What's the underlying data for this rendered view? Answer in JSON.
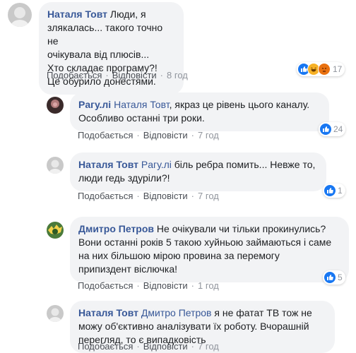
{
  "comments": [
    {
      "author": "Наталя Товт",
      "lines": [
        "Люди, я злякалась... такого точно не",
        "очікувала від плюсів...",
        "Хто складає програму?!",
        "Це обурило донестями."
      ],
      "like_label": "Подобається",
      "reply_label": "Відповісти",
      "time": "8 год",
      "reactions": [
        "like",
        "haha",
        "angry"
      ],
      "reaction_count": "17"
    },
    {
      "author": "Paгу.лі",
      "mention": "Наталя Товт",
      "lines": [
        ", якраз це рівень цього каналу.",
        "Особливо останні три роки."
      ],
      "like_label": "Подобається",
      "reply_label": "Відповісти",
      "time": "7 год",
      "reactions": [
        "like"
      ],
      "reaction_count": "24"
    },
    {
      "author": "Наталя Товт",
      "mention": "Paгу.лі",
      "lines": [
        " біль ребра помить... Невже то,",
        "люди гедь здуріли?!"
      ],
      "like_label": "Подобається",
      "reply_label": "Відповісти",
      "time": "7 год",
      "reactions": [
        "like"
      ],
      "reaction_count": "1"
    },
    {
      "author": "Дмитро Петров",
      "lines": [
        " Не очікували чи тільки прокинулись?",
        "Вони останні років 5 такою хуйньою займаються і саме",
        "на них більшою мірою провина за перемогу",
        "припиздент віслючка!"
      ],
      "like_label": "Подобається",
      "reply_label": "Відповісти",
      "time": "1 год",
      "reactions": [
        "like"
      ],
      "reaction_count": "5"
    },
    {
      "author": "Наталя Товт",
      "mention": "Дмитро Петров",
      "lines": [
        " я не фатат ТВ тож не",
        "можу об'єктивно аналізувати їх роботу. Вчорашній",
        "перегляд, то є випадковість"
      ],
      "like_label": "Подобається",
      "reply_label": "Відповісти",
      "time": "7 год"
    }
  ],
  "separator": "·",
  "colors": {
    "link": "#385898",
    "bubble": "#f2f3f5",
    "like": "#1877f2"
  }
}
